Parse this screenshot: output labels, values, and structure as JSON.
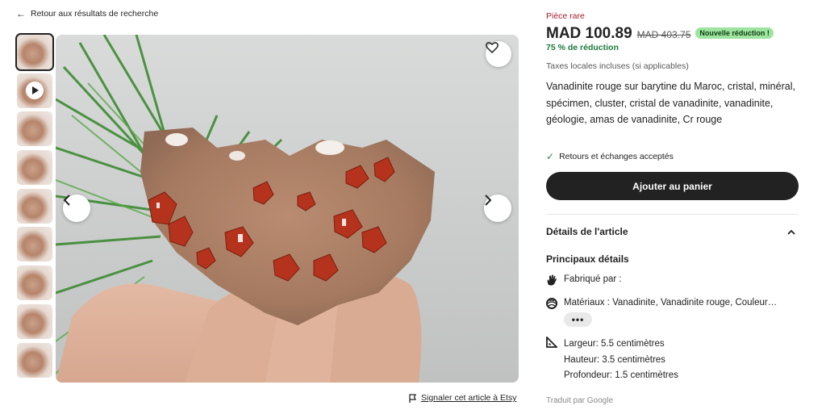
{
  "nav": {
    "back_label": "Retour aux résultats de recherche"
  },
  "gallery": {
    "thumbnail_count": 9,
    "report_label": "Signaler cet article à Etsy"
  },
  "product": {
    "rare_label": "Pièce rare",
    "price": "MAD 100.89",
    "old_price": "MAD 403.75",
    "badge": "Nouvelle réduction !",
    "discount": "75 % de réduction",
    "tax_note": "Taxes locales incluses (si applicables)",
    "title": "Vanadinite rouge sur barytine du Maroc, cristal, minéral, spécimen, cluster, cristal de vanadinite, vanadinite, géologie, amas de vanadinite, Cr rouge",
    "returns": "Retours et échanges acceptés",
    "add_to_cart": "Ajouter au panier"
  },
  "details": {
    "section_title": "Détails de l'article",
    "highlights_title": "Principaux détails",
    "made_by": "Fabriqué par :",
    "materials": "Matériaux : Vanadinite, Vanadinite rouge, Couleur…",
    "more_label": "•••",
    "width": "Largeur: 5.5 centimètres",
    "height": "Hauteur: 3.5 centimètres",
    "depth": "Profondeur: 1.5 centimètres",
    "translated_by": "Traduit par Google"
  },
  "colors": {
    "rare": "#a61a2e",
    "discount": "#1d7a3c",
    "badge_bg": "#9ee39e",
    "button_bg": "#222222"
  },
  "icons": {
    "back": "arrow-left-icon",
    "favorite": "heart-icon",
    "prev": "chevron-left-icon",
    "next": "chevron-right-icon",
    "play": "play-icon",
    "report": "flag-icon",
    "check": "check-icon",
    "collapse": "chevron-up-icon",
    "made_by": "hand-icon",
    "materials": "layers-icon",
    "size": "ruler-icon"
  }
}
